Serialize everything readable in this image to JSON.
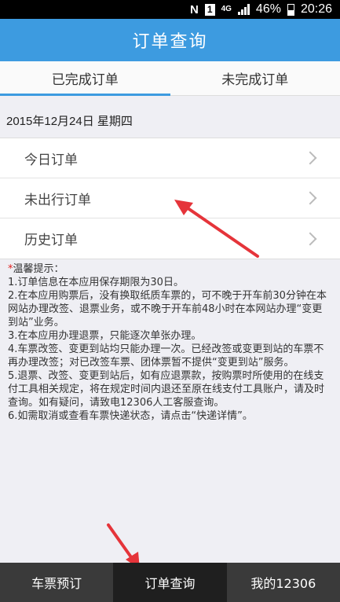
{
  "status_bar": {
    "n_icon": "N",
    "sim_badge": "1",
    "network": "4G",
    "battery": "46%",
    "time": "20:26"
  },
  "header": {
    "title": "订单查询"
  },
  "tabs": [
    {
      "label": "已完成订单",
      "active": true
    },
    {
      "label": "未完成订单",
      "active": false
    }
  ],
  "date_line": "2015年12月24日 星期四",
  "orders": [
    {
      "label": "今日订单",
      "icon": "chevron-right-icon"
    },
    {
      "label": "未出行订单",
      "icon": "chevron-right-icon"
    },
    {
      "label": "历史订单",
      "icon": "chevron-right-icon"
    }
  ],
  "tips": {
    "star": "*",
    "heading": "温馨提示：",
    "items": [
      "1.订单信息在本应用保存期限为30日。",
      "2.在本应用购票后，没有换取纸质车票的，可不晚于开车前30分钟在本网站办理改签、退票业务，或不晚于开车前48小时在本网站办理“变更到站”业务。",
      "3.在本应用办理退票，只能逐次单张办理。",
      "4.车票改签、变更到站均只能办理一次。已经改签或变更到站的车票不再办理改签；对已改签车票、团体票暂不提供“变更到站”服务。",
      "5.退票、改签、变更到站后，如有应退票款，按购票时所使用的在线支付工具相关规定，将在规定时间内退还至原在线支付工具账户，请及时查询。如有疑问，请致电12306人工客服查询。",
      "6.如需取消或查看车票快递状态，请点击“快递详情”。"
    ]
  },
  "bottom_nav": [
    {
      "label": "车票预订",
      "active": false
    },
    {
      "label": "订单查询",
      "active": true
    },
    {
      "label": "我的12306",
      "active": false
    }
  ],
  "colors": {
    "header": "#3d9be0",
    "nav": "#3a3a3a",
    "nav_active": "#1f1f1f",
    "arrow": "#e5343a"
  }
}
